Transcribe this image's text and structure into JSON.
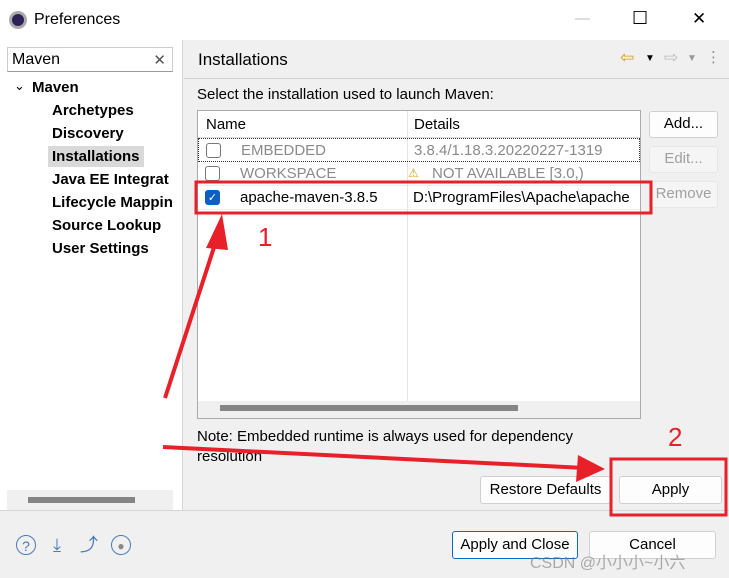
{
  "window": {
    "title": "Preferences",
    "minimize": "—",
    "maximize": "☐",
    "close": "✕"
  },
  "sidebar": {
    "search_value": "Maven",
    "clear": "✕",
    "root": {
      "label": "Maven",
      "expander": "⌄"
    },
    "items": [
      {
        "label": "Archetypes"
      },
      {
        "label": "Discovery"
      },
      {
        "label": "Installations"
      },
      {
        "label": "Java EE Integrat"
      },
      {
        "label": "Lifecycle Mappin"
      },
      {
        "label": "Source Lookup"
      },
      {
        "label": "User Settings"
      }
    ]
  },
  "page": {
    "title": "Installations",
    "back": "⇦",
    "fwd": "⇨",
    "menu": "⋮",
    "label": "Select the installation used to launch Maven:",
    "table": {
      "columns": [
        "Name",
        "Details"
      ],
      "rows": [
        {
          "name": "EMBEDDED",
          "details": "3.8.4/1.18.3.20220227-1319",
          "checked": false,
          "warning": false
        },
        {
          "name": "WORKSPACE",
          "details": "NOT AVAILABLE [3.0,)",
          "checked": false,
          "warning": true
        },
        {
          "name": "apache-maven-3.8.5",
          "details": "D:\\ProgramFiles\\Apache\\apache",
          "checked": true,
          "warning": false
        }
      ]
    },
    "buttons": {
      "add": "Add...",
      "edit": "Edit...",
      "remove": "Remove"
    },
    "note": "Note: Embedded runtime is always used for dependency resolution",
    "restore": "Restore Defaults",
    "apply": "Apply"
  },
  "footer": {
    "apply_close": "Apply and Close",
    "cancel": "Cancel"
  },
  "annotations": {
    "one": "1",
    "two": "2",
    "color": "#e8202a"
  },
  "watermark": "CSDN @小小小~小六"
}
